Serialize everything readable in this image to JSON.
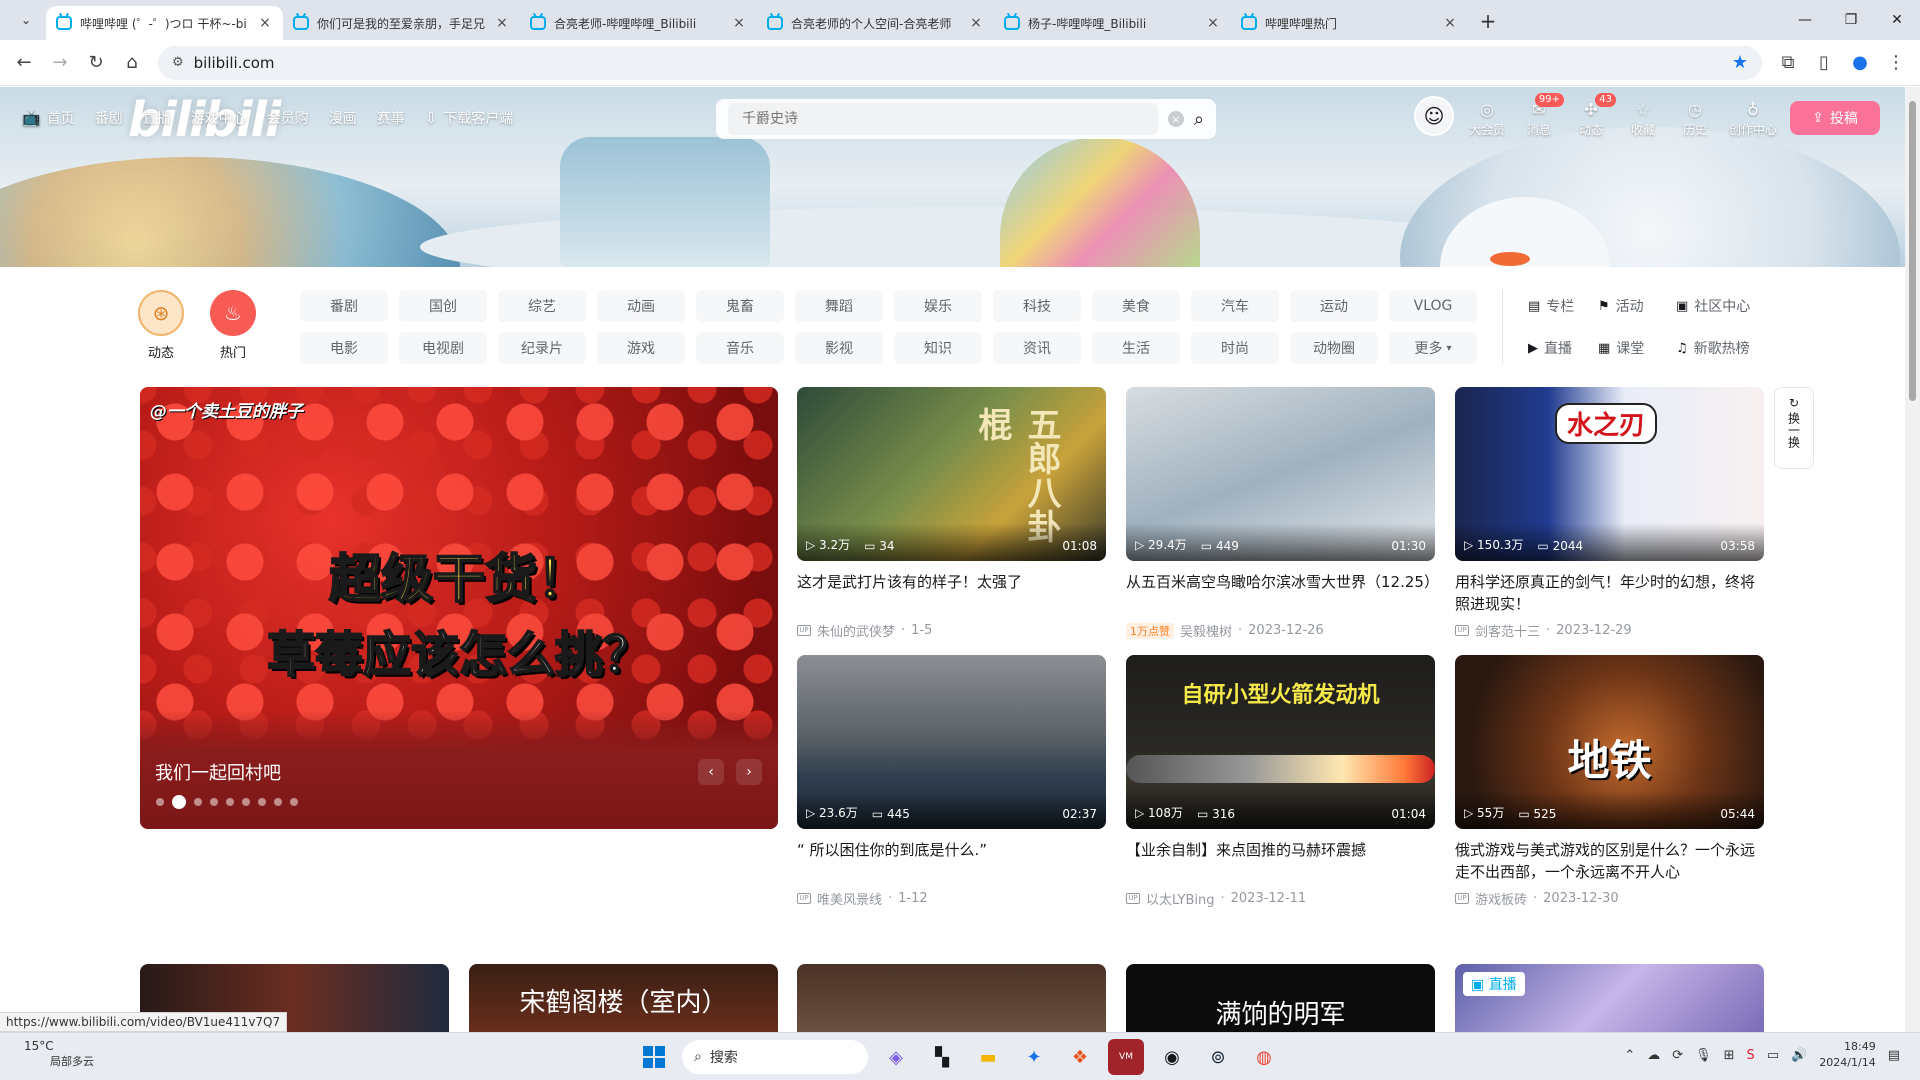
{
  "browser": {
    "tabs": [
      {
        "title": "哔哩哔哩 (゜-゜)つロ 干杯~-bi",
        "active": true
      },
      {
        "title": "你们可是我的至爱亲朋，手足兄",
        "active": false
      },
      {
        "title": "合亮老师-哔哩哔哩_Bilibili",
        "active": false
      },
      {
        "title": "合亮老师的个人空间-合亮老师",
        "active": false
      },
      {
        "title": "杨子-哔哩哔哩_Bilibili",
        "active": false
      },
      {
        "title": "哔哩哔哩热门",
        "active": false
      }
    ],
    "url": "bilibili.com"
  },
  "header": {
    "logo": "bilibili",
    "nav": [
      "首页",
      "番剧",
      "直播",
      "游戏中心",
      "会员购",
      "漫画",
      "赛事",
      "下载客户端"
    ],
    "search_placeholder": "千爵史诗",
    "user_items": [
      {
        "label": "大会员",
        "icon": "vip-icon",
        "badge": ""
      },
      {
        "label": "消息",
        "icon": "message-icon",
        "badge": "99+"
      },
      {
        "label": "动态",
        "icon": "dynamic-icon",
        "badge": "43"
      },
      {
        "label": "收藏",
        "icon": "star-icon",
        "badge": ""
      },
      {
        "label": "历史",
        "icon": "clock-icon",
        "badge": ""
      },
      {
        "label": "创作中心",
        "icon": "bulb-icon",
        "badge": ""
      }
    ],
    "upload_label": "投稿"
  },
  "quick": [
    {
      "label": "动态"
    },
    {
      "label": "热门"
    }
  ],
  "channels": [
    "番剧",
    "国创",
    "综艺",
    "动画",
    "鬼畜",
    "舞蹈",
    "娱乐",
    "科技",
    "美食",
    "汽车",
    "运动",
    "VLOG",
    "电影",
    "电视剧",
    "纪录片",
    "游戏",
    "音乐",
    "影视",
    "知识",
    "资讯",
    "生活",
    "时尚",
    "动物圈",
    "更多"
  ],
  "side_links": [
    "专栏",
    "活动",
    "社区中心",
    "直播",
    "课堂",
    "新歌热榜"
  ],
  "carousel": {
    "channel_tag": "@一个卖土豆的胖子",
    "headline1": "超级干货！",
    "headline2": "草莓应该怎么挑？",
    "caption": "我们一起回村吧"
  },
  "cards": [
    {
      "views": "3.2万",
      "danmaku": "34",
      "duration": "01:08",
      "title": "这才是武打片该有的样子！太强了",
      "author": "朱仙的武侠梦",
      "date": "1-5",
      "tag": "",
      "thumb_text": "五郎八卦棍"
    },
    {
      "views": "29.4万",
      "danmaku": "449",
      "duration": "01:30",
      "title": "从五百米高空鸟瞰哈尔滨冰雪大世界（12.25）",
      "author": "吴毅槐树",
      "date": "2023-12-26",
      "tag": "1万点赞",
      "thumb_text": ""
    },
    {
      "views": "150.3万",
      "danmaku": "2044",
      "duration": "03:58",
      "title": "用科学还原真正的剑气！年少时的幻想，终将照进现实！",
      "author": "剑客范十三",
      "date": "2023-12-29",
      "tag": "",
      "thumb_text": "水之刃"
    },
    {
      "views": "23.6万",
      "danmaku": "445",
      "duration": "02:37",
      "title": "“ 所以困住你的到底是什么.”",
      "author": "唯美风景线",
      "date": "1-12",
      "tag": "",
      "thumb_text": ""
    },
    {
      "views": "108万",
      "danmaku": "316",
      "duration": "01:04",
      "title": "【业余自制】来点固推的马赫环震撼",
      "author": "以太LYBing",
      "date": "2023-12-11",
      "tag": "",
      "thumb_text": "自研小型火箭发动机"
    },
    {
      "views": "55万",
      "danmaku": "525",
      "duration": "05:44",
      "title": "俄式游戏与美式游戏的区别是什么？一个永远走不出西部，一个永远离不开人心",
      "author": "游戏板砖",
      "date": "2023-12-30",
      "tag": "",
      "thumb_text": "地铁"
    }
  ],
  "row3": [
    {
      "text": "",
      "live": ""
    },
    {
      "text": "宋鹤阁楼（室内）",
      "live": ""
    },
    {
      "text": "",
      "live": ""
    },
    {
      "text": "满饷的明军",
      "live": ""
    },
    {
      "text": "",
      "live": "直播"
    }
  ],
  "refresh_label": "换一换",
  "status_url": "https://www.bilibili.com/video/BV1ue411v7Q7",
  "taskbar": {
    "weather_temp": "15°C",
    "weather_desc": "局部多云",
    "search_label": "搜索",
    "time": "18:49",
    "date": "2024/1/14"
  }
}
